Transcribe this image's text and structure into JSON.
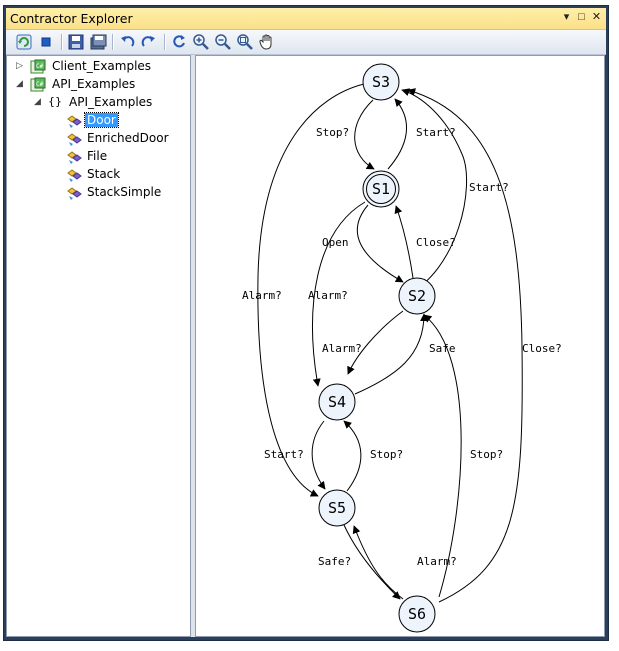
{
  "window": {
    "title": "Contractor Explorer",
    "controls": [
      "▾",
      "□",
      "✕"
    ]
  },
  "toolbar": {
    "buttons": [
      "refresh-icon",
      "stop-icon",
      "save-icon",
      "save-all-icon",
      "undo-icon",
      "redo-icon",
      "reset-icon",
      "zoom-in-icon",
      "zoom-out-icon",
      "zoom-fit-icon",
      "pan-hand-icon"
    ]
  },
  "tree": {
    "project1": "Client_Examples",
    "project2": "API_Examples",
    "namespace": "API_Examples",
    "namespace_glyph": "{}",
    "cs_badge": "C#",
    "contracts": [
      "Door",
      "EnrichedDoor",
      "File",
      "Stack",
      "StackSimple"
    ],
    "selected": "Door"
  },
  "graph": {
    "states": [
      "S3",
      "S1",
      "S2",
      "S4",
      "S5",
      "S6"
    ],
    "initial_state": "S1",
    "transitions": [
      {
        "from": "S3",
        "to": "S1",
        "label": "Stop?"
      },
      {
        "from": "S1",
        "to": "S3",
        "label": "Start?"
      },
      {
        "from": "S2",
        "to": "S3",
        "label": "Start?"
      },
      {
        "from": "S1",
        "to": "S2",
        "label": "Open"
      },
      {
        "from": "S2",
        "to": "S1",
        "label": "Close?"
      },
      {
        "from": "S3",
        "to": "S5",
        "label": "Alarm?"
      },
      {
        "from": "S1",
        "to": "S4",
        "label": "Alarm?"
      },
      {
        "from": "S2",
        "to": "S4",
        "label": "Alarm?"
      },
      {
        "from": "S4",
        "to": "S2",
        "label": "Safe"
      },
      {
        "from": "S6",
        "to": "S3",
        "label": "Close?"
      },
      {
        "from": "S4",
        "to": "S5",
        "label": "Start?"
      },
      {
        "from": "S5",
        "to": "S4",
        "label": "Stop?"
      },
      {
        "from": "S6",
        "to": "S2",
        "label": "Stop?"
      },
      {
        "from": "S5",
        "to": "S6",
        "label": "Safe?"
      },
      {
        "from": "S6",
        "to": "S5",
        "label": "Alarm?"
      }
    ]
  }
}
